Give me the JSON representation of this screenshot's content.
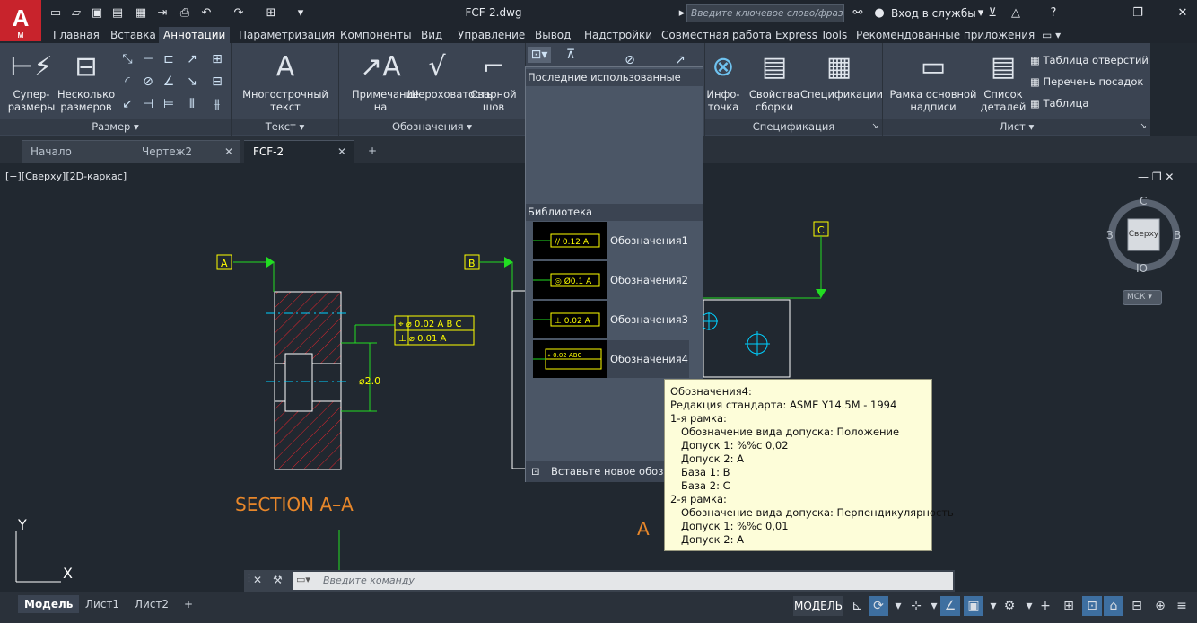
{
  "app": {
    "logo_letter": "A",
    "logo_sub": "M",
    "doc_title": "FCF-2.dwg"
  },
  "titlebar": {
    "search_placeholder": "Введите ключевое слово/фразу",
    "login": "Вход в службы",
    "help": "?"
  },
  "menu": [
    "Главная",
    "Вставка",
    "Аннотации",
    "Параметризация",
    "Компоненты",
    "Вид",
    "Управление",
    "Вывод",
    "Надстройки",
    "Совместная работа",
    "Express Tools",
    "Рекомендованные приложения"
  ],
  "menu_active": "Аннотации",
  "ribbon": {
    "dim_panel": {
      "label": "Размер",
      "btn1": "Супер-размеры",
      "btn2": "Несколько размеров"
    },
    "text_panel": {
      "label": "Текст",
      "btn1": "Многострочный текст"
    },
    "sym_panel": {
      "label": "Обозначения",
      "btn1": "Примечание на",
      "btn2": "Шероховатость",
      "btn3": "Сварной шов"
    },
    "spec_panel": {
      "label": "Спецификация",
      "btn1": "Инфо-точка",
      "btn2": "Свойства сборки",
      "btn3": "Спецификации"
    },
    "sheet_panel": {
      "label": "Лист",
      "btn1": "Рамка основной надписи",
      "btn2": "Список деталей",
      "list": [
        "Таблица отверстий",
        "Перечень посадок",
        "Таблица"
      ]
    }
  },
  "file_tabs": [
    {
      "label": "Начало"
    },
    {
      "label": "Чертеж2"
    },
    {
      "label": "FCF-2"
    }
  ],
  "viewport": {
    "label": "[−][Сверху][2D-каркас]",
    "section_label": "SECTION A–A",
    "datum_a": "A",
    "datum_b": "B",
    "datum_c": "C",
    "fcf1_row1": "⌖ ⌀ 0.02 A B C",
    "fcf1_row2": "⊥ ⌀ 0.01 A",
    "dim_value": "⌀2.0",
    "section_letter": "A",
    "viewcube": {
      "face": "Сверху",
      "n": "С",
      "s": "Ю",
      "w": "З",
      "e": "В"
    },
    "ucs": "МСК",
    "axis_y": "Y",
    "axis_x": "X"
  },
  "popup": {
    "recent_header": "Последние использованные",
    "library_header": "Библиотека",
    "items": [
      {
        "name": "Обозначения1",
        "thumb": "// 0.12 A"
      },
      {
        "name": "Обозначения2",
        "thumb": "◎ Ø0.1 A"
      },
      {
        "name": "Обозначения3",
        "thumb": "⊥ 0.02 A"
      },
      {
        "name": "Обозначения4",
        "thumb": "⌖ 0.02 ABC"
      }
    ],
    "footer": "Вставьте новое обозначение"
  },
  "tooltip": {
    "lines": [
      {
        "text": "Обозначения4:",
        "indent": false
      },
      {
        "text": "Редакция стандарта: ASME Y14.5M - 1994",
        "indent": false
      },
      {
        "text": "1-я рамка:",
        "indent": false
      },
      {
        "text": "Обозначение вида допуска: Положение",
        "indent": true
      },
      {
        "text": "Допуск 1: %%c 0,02",
        "indent": true
      },
      {
        "text": "Допуск 2: A",
        "indent": true
      },
      {
        "text": "База 1: B",
        "indent": true
      },
      {
        "text": "База 2: C",
        "indent": true
      },
      {
        "text": "2-я рамка:",
        "indent": false
      },
      {
        "text": "Обозначение вида допуска: Перпендикулярность",
        "indent": true
      },
      {
        "text": "Допуск 1: %%c 0,01",
        "indent": true
      },
      {
        "text": "Допуск 2: A",
        "indent": true
      }
    ]
  },
  "command": {
    "placeholder": "Введите команду"
  },
  "status": {
    "layout_tabs": [
      "Модель",
      "Лист1",
      "Лист2"
    ],
    "model_btn": "МОДЕЛЬ"
  }
}
